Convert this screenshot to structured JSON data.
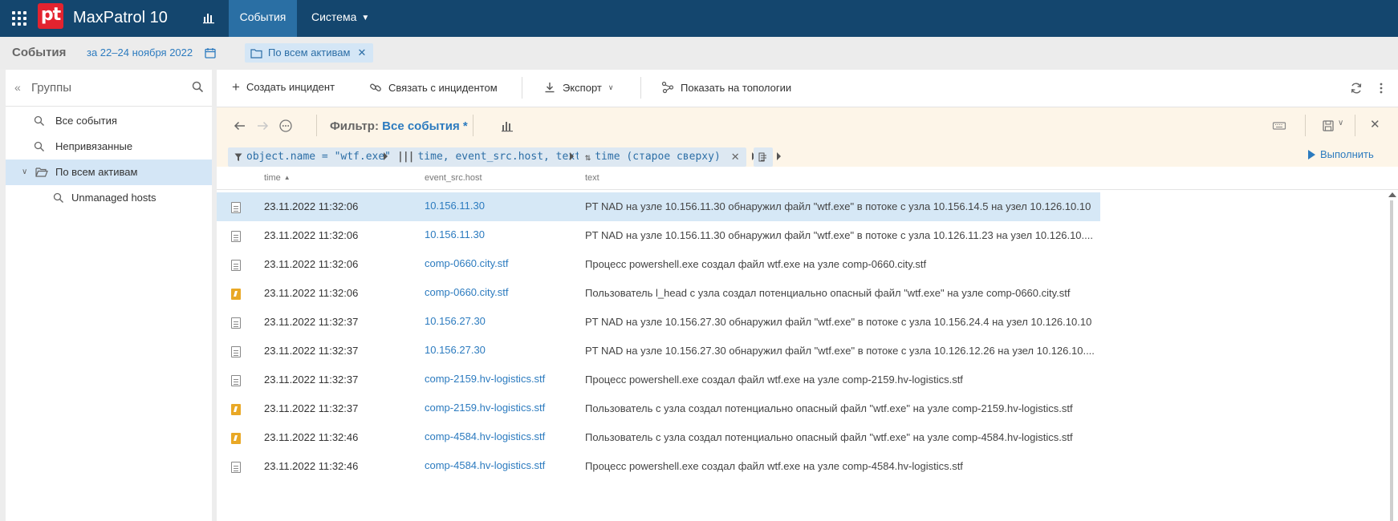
{
  "topnav": {
    "app_title": "MaxPatrol 10",
    "tabs": [
      {
        "label": "События",
        "active": true
      },
      {
        "label": "Система",
        "active": false,
        "has_dropdown": true
      }
    ],
    "logo_text": "pt",
    "icons": [
      "apps-grid-icon",
      "stats-icon",
      "chevron-down-icon"
    ]
  },
  "subheader": {
    "title": "События",
    "date_range": "за 22–24 ноября 2022",
    "asset_chip": "По всем активам"
  },
  "groups_panel": {
    "title": "Группы",
    "items": [
      {
        "label": "Все события",
        "icon": "search-icon",
        "selected": false
      },
      {
        "label": "Непривязанные",
        "icon": "search-icon",
        "selected": false
      },
      {
        "label": "По всем активам",
        "icon": "folder-open-icon",
        "selected": true,
        "expanded": true
      },
      {
        "label": "Unmanaged hosts",
        "icon": "search-icon",
        "selected": false,
        "child": true
      }
    ]
  },
  "toolbar": {
    "create_incident": "Создать инцидент",
    "link_incident": "Связать с инцидентом",
    "export": "Экспорт",
    "show_topology": "Показать на топологии"
  },
  "filterbar": {
    "filter_label": "Фильтр:",
    "filter_name": "Все события *",
    "chips": {
      "condition": "object.name = \"wtf.exe\"",
      "columns": "time, event_src.host, text",
      "sort": "time (старое сверху)"
    },
    "run_label": "Выполнить"
  },
  "table": {
    "columns": [
      "time",
      "event_src.host",
      "text"
    ],
    "sort_column": "time",
    "sort_direction": "asc",
    "rows": [
      {
        "type": "event",
        "time": "23.11.2022 11:32:06",
        "host": "10.156.11.30",
        "text": "PT NAD на узле 10.156.11.30 обнаружил файл \"wtf.exe\" в потоке с узла 10.156.14.5 на узел 10.126.10.10",
        "selected": true
      },
      {
        "type": "event",
        "time": "23.11.2022 11:32:06",
        "host": "10.156.11.30",
        "text": "PT NAD на узле 10.156.11.30 обнаружил файл \"wtf.exe\" в потоке с узла 10.126.11.23 на узел 10.126.10....",
        "selected": false
      },
      {
        "type": "event",
        "time": "23.11.2022 11:32:06",
        "host": "comp-0660.city.stf",
        "text": "Процесс powershell.exe создал файл wtf.exe на узле comp-0660.city.stf",
        "selected": false
      },
      {
        "type": "incident",
        "time": "23.11.2022 11:32:06",
        "host": "comp-0660.city.stf",
        "text": "Пользователь l_head с узла  создал потенциально опасный файл \"wtf.exe\" на узле comp-0660.city.stf",
        "selected": false
      },
      {
        "type": "event",
        "time": "23.11.2022 11:32:37",
        "host": "10.156.27.30",
        "text": "PT NAD на узле 10.156.27.30 обнаружил файл \"wtf.exe\" в потоке с узла 10.156.24.4 на узел 10.126.10.10",
        "selected": false
      },
      {
        "type": "event",
        "time": "23.11.2022 11:32:37",
        "host": "10.156.27.30",
        "text": "PT NAD на узле 10.156.27.30 обнаружил файл \"wtf.exe\" в потоке с узла 10.126.12.26 на узел 10.126.10....",
        "selected": false
      },
      {
        "type": "event",
        "time": "23.11.2022 11:32:37",
        "host": "comp-2159.hv-logistics.stf",
        "text": "Процесс powershell.exe создал файл wtf.exe на узле comp-2159.hv-logistics.stf",
        "selected": false
      },
      {
        "type": "incident",
        "time": "23.11.2022 11:32:37",
        "host": "comp-2159.hv-logistics.stf",
        "text": "Пользователь  с узла  создал потенциально опасный файл \"wtf.exe\" на узле comp-2159.hv-logistics.stf",
        "selected": false
      },
      {
        "type": "incident",
        "time": "23.11.2022 11:32:46",
        "host": "comp-4584.hv-logistics.stf",
        "text": "Пользователь  с узла  создал потенциально опасный файл \"wtf.exe\" на узле comp-4584.hv-logistics.stf",
        "selected": false
      },
      {
        "type": "event",
        "time": "23.11.2022 11:32:46",
        "host": "comp-4584.hv-logistics.stf",
        "text": "Процесс powershell.exe создал файл wtf.exe на узле comp-4584.hv-logistics.stf",
        "selected": false
      }
    ]
  },
  "colors": {
    "nav_bg": "#14466e",
    "nav_active": "#2a6fa4",
    "accent": "#2c7bbf",
    "selected_row": "#d6e8f6",
    "filter_bg": "#fdf5e8",
    "logo_red": "#e3232f",
    "incident_icon": "#e9a825"
  }
}
